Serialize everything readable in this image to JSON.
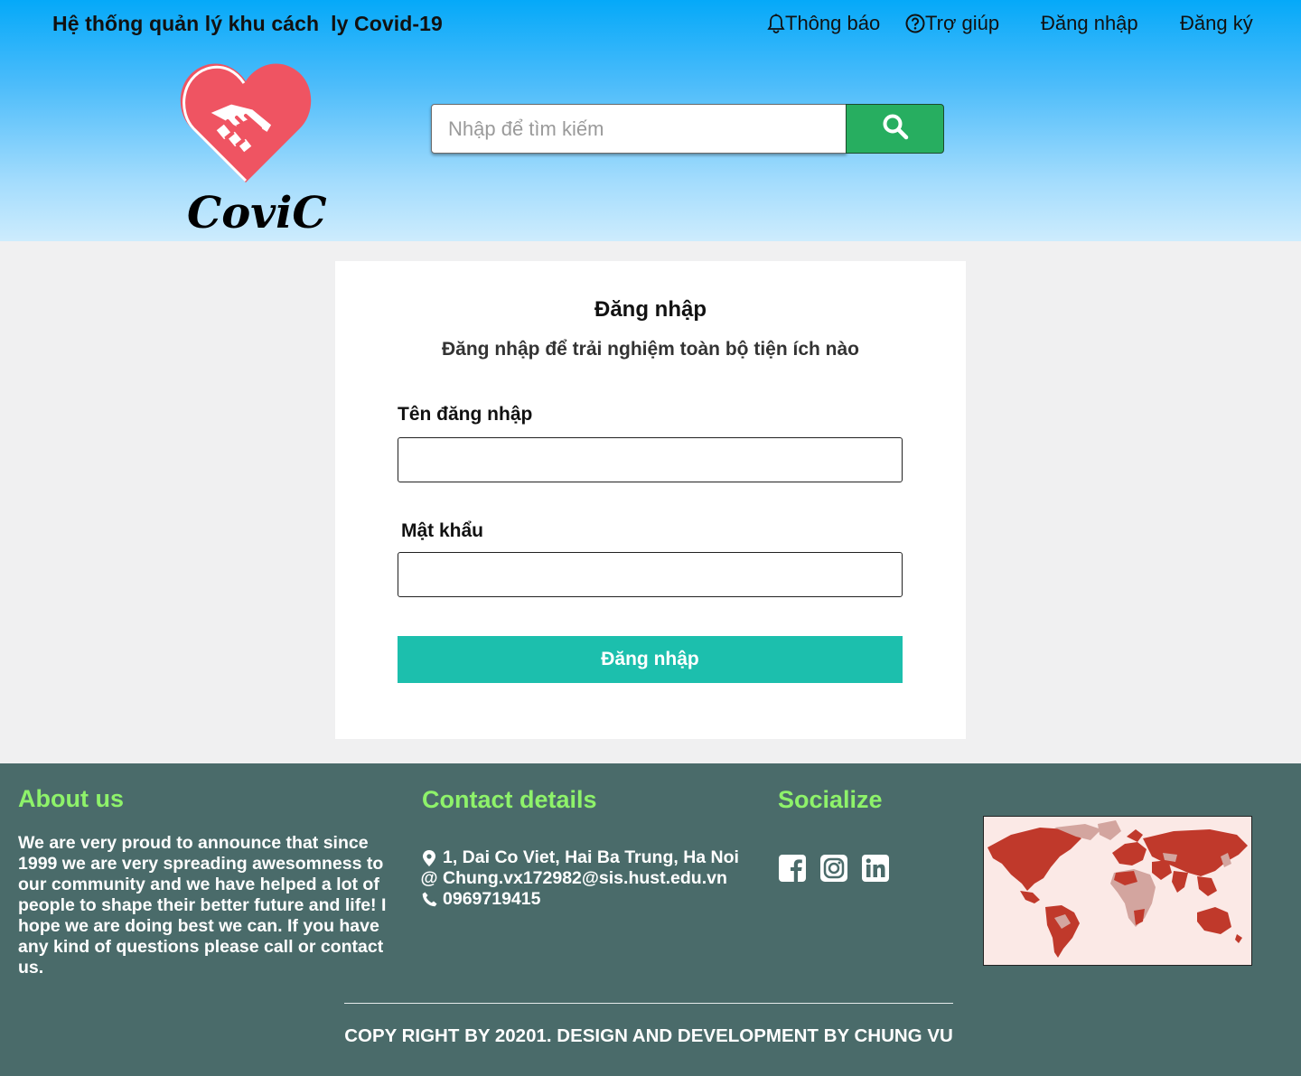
{
  "header": {
    "site_title": "Hệ thống quản lý khu cách  ly Covid-19",
    "nav": {
      "notify": "Thông báo",
      "help": "Trợ giúp",
      "login": "Đăng nhập",
      "register": "Đăng ký"
    },
    "logo_text": "CoviC",
    "search": {
      "placeholder": "Nhập để tìm kiếm",
      "value": ""
    }
  },
  "login_card": {
    "title": "Đăng nhập",
    "subtitle": "Đăng nhập để trải nghiệm toàn bộ tiện ích nào",
    "username_label": "Tên đăng nhập",
    "username_value": "",
    "password_label": "Mật khẩu",
    "password_value": "",
    "submit_label": "Đăng nhập"
  },
  "footer": {
    "about": {
      "heading": "About us",
      "text": "We are very proud to announce that since 1999 we are very spreading awesomness to our community and we have helped a lot of people to shape their better future and life! I hope we are doing best we can. If you have any kind of questions please call or contact us."
    },
    "contact": {
      "heading": "Contact details",
      "address": "1, Dai Co Viet, Hai Ba Trung, Ha Noi",
      "email_symbol": "@",
      "email": "Chung.vx172982@sis.hust.edu.vn",
      "phone": "0969719415"
    },
    "socialize": {
      "heading": "Socialize",
      "icons": [
        "facebook-icon",
        "instagram-icon",
        "linkedin-icon"
      ]
    },
    "copyright": "COPY RIGHT BY 20201. DESIGN AND DEVELOPMENT BY CHUNG VU"
  },
  "colors": {
    "header_top": "#05a9f9",
    "search_button": "#27ae60",
    "login_button": "#1cbfad",
    "footer_bg": "#4a6b6a",
    "footer_heading": "#8ef26a",
    "logo_heart": "#ef5462",
    "map_land": "#c0392b"
  }
}
